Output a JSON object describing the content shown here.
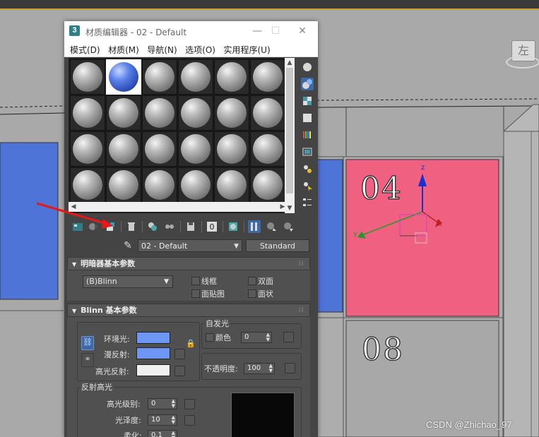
{
  "window": {
    "app_icon": "3",
    "title": "材质编辑器 - 02 - Default",
    "minimize": "—",
    "maximize": "☐",
    "close": "✕"
  },
  "menu": [
    "模式(D)",
    "材质(M)",
    "导航(N)",
    "选项(O)",
    "实用程序(U)"
  ],
  "material": {
    "name": "02 - Default",
    "type_button": "Standard"
  },
  "shader_rollout": {
    "title": "明暗器基本参数",
    "shader": "(B)Blinn",
    "wire": "线框",
    "two_sided": "双面",
    "face_map": "面贴图",
    "faceted": "面状"
  },
  "blinn_rollout": {
    "title": "Blinn 基本参数",
    "self_illum_group": "自发光",
    "color_label": "颜色",
    "self_illum_value": "0",
    "ambient_label": "环境光:",
    "diffuse_label": "漫反射:",
    "specular_label": "高光反射:",
    "ambient_color": "#6e97f5",
    "diffuse_color": "#6e97f5",
    "specular_color": "#f0f0f0",
    "opacity_label": "不透明度:",
    "opacity_value": "100",
    "spec_group": "反射高光",
    "spec_level_label": "高光级别:",
    "spec_level_value": "0",
    "glossiness_label": "光泽度:",
    "glossiness_value": "10",
    "soften_label": "柔化:",
    "soften_value": "0.1"
  },
  "scene": {
    "label_04": "04",
    "label_08": "08",
    "viewcube_label": "左",
    "pink_panel_color": "#f06080",
    "blue_panel_color": "#4f74d8",
    "axis_z": "z",
    "axis_y": "y",
    "axis_x": "x"
  },
  "watermark": "CSDN @Zhichao_97"
}
